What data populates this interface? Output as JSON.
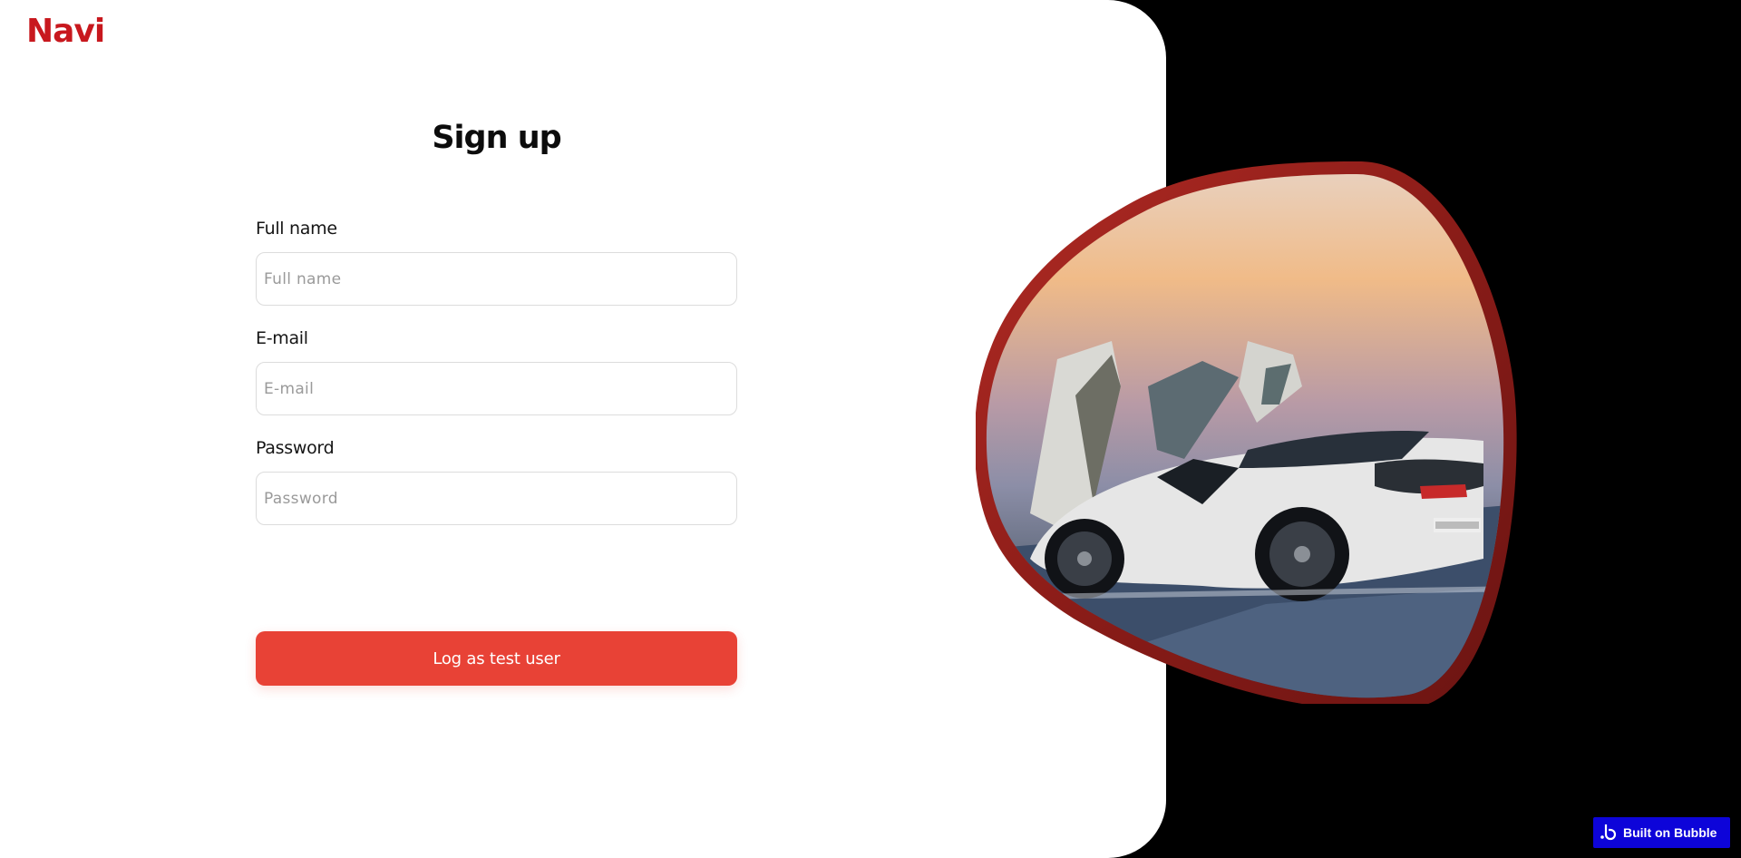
{
  "brand": {
    "logo": "Navi",
    "color": "#c8181e"
  },
  "form": {
    "title": "Sign up",
    "fields": [
      {
        "label": "Full name",
        "placeholder": "Full name",
        "value": ""
      },
      {
        "label": "E-mail",
        "placeholder": "E-mail",
        "value": ""
      },
      {
        "label": "Password",
        "placeholder": "Password",
        "value": ""
      }
    ],
    "submit_label": "Log as test user",
    "accent": "#e84236"
  },
  "hero": {
    "icon": "sports-car-image",
    "frame_color": "#9b1f1b"
  },
  "badge": {
    "label": "Built on Bubble",
    "icon": "bubble-logo-icon",
    "color": "#0d04d9"
  }
}
